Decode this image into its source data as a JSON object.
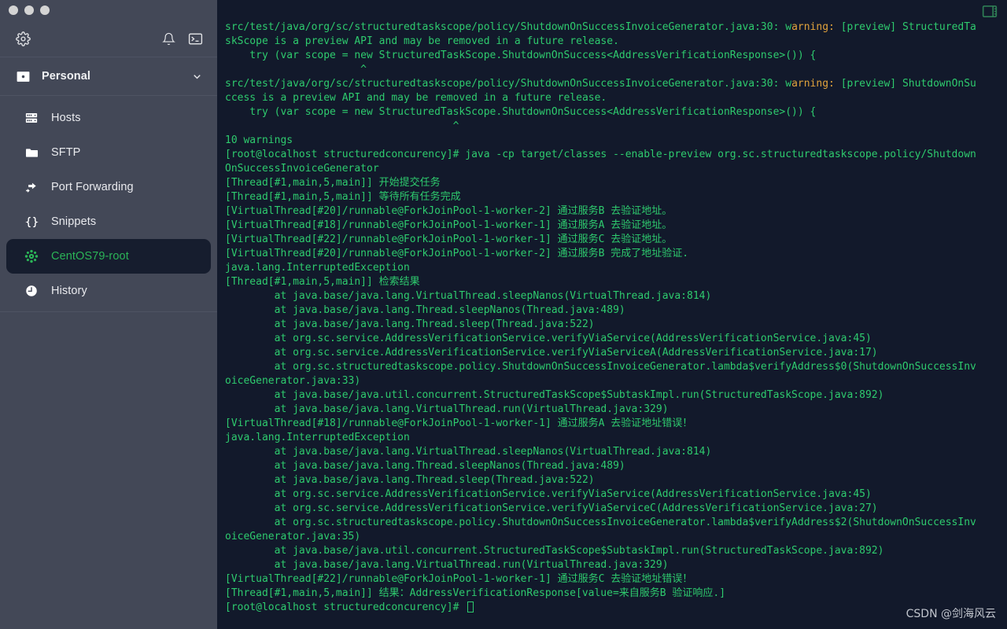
{
  "window": {
    "dots": [
      "close",
      "minimize",
      "maximize"
    ]
  },
  "sidebar": {
    "toolbar": {
      "settings_icon": "gear-icon",
      "notifications_icon": "bell-icon",
      "terminal_icon": "terminal-icon"
    },
    "vault": {
      "icon": "vault-icon",
      "label": "Personal",
      "chevron": "chevron-down-icon"
    },
    "items": [
      {
        "icon": "server-icon",
        "label": "Hosts",
        "selected": false
      },
      {
        "icon": "folder-icon",
        "label": "SFTP",
        "selected": false
      },
      {
        "icon": "port-forwarding-icon",
        "label": "Port Forwarding",
        "selected": false
      },
      {
        "icon": "braces-icon",
        "label": "Snippets",
        "selected": false
      },
      {
        "icon": "centos-icon",
        "label": "CentOS79-root",
        "selected": true
      },
      {
        "icon": "clock-icon",
        "label": "History",
        "selected": false
      }
    ]
  },
  "terminal": {
    "split_pane_icon": "split-pane-icon",
    "watermark": "CSDN @剑海风云",
    "prompt": "[root@localhost structuredconcurency]# ",
    "lines": [
      {
        "text": "src/test/java/org/sc/structuredtaskscope/policy/ShutdownOnSuccessInvoiceGenerator.java:30: warning: [preview] StructuredTa",
        "warn_from": 92,
        "warn_to": 100
      },
      {
        "text": "skScope is a preview API and may be removed in a future release."
      },
      {
        "text": "    try (var scope = new StructuredTaskScope.ShutdownOnSuccess<AddressVerificationResponse>()) {"
      },
      {
        "text": "                      ^"
      },
      {
        "text": "src/test/java/org/sc/structuredtaskscope/policy/ShutdownOnSuccessInvoiceGenerator.java:30: warning: [preview] ShutdownOnSu",
        "warn_from": 92,
        "warn_to": 100
      },
      {
        "text": "ccess is a preview API and may be removed in a future release."
      },
      {
        "text": "    try (var scope = new StructuredTaskScope.ShutdownOnSuccess<AddressVerificationResponse>()) {"
      },
      {
        "text": "                                     ^"
      },
      {
        "text": "10 warnings"
      },
      {
        "text": "[root@localhost structuredconcurency]# java -cp target/classes --enable-preview org.sc.structuredtaskscope.policy/Shutdown"
      },
      {
        "text": "OnSuccessInvoiceGenerator"
      },
      {
        "text": "[Thread[#1,main,5,main]] 开始提交任务"
      },
      {
        "text": "[Thread[#1,main,5,main]] 等待所有任务完成"
      },
      {
        "text": "[VirtualThread[#20]/runnable@ForkJoinPool-1-worker-2] 通过服务B 去验证地址。"
      },
      {
        "text": "[VirtualThread[#18]/runnable@ForkJoinPool-1-worker-1] 通过服务A 去验证地址。"
      },
      {
        "text": "[VirtualThread[#22]/runnable@ForkJoinPool-1-worker-1] 通过服务C 去验证地址。"
      },
      {
        "text": "[VirtualThread[#20]/runnable@ForkJoinPool-1-worker-2] 通过服务B 完成了地址验证."
      },
      {
        "text": "java.lang.InterruptedException"
      },
      {
        "text": "[Thread[#1,main,5,main]] 检索结果"
      },
      {
        "text": "        at java.base/java.lang.VirtualThread.sleepNanos(VirtualThread.java:814)"
      },
      {
        "text": "        at java.base/java.lang.Thread.sleepNanos(Thread.java:489)"
      },
      {
        "text": "        at java.base/java.lang.Thread.sleep(Thread.java:522)"
      },
      {
        "text": "        at org.sc.service.AddressVerificationService.verifyViaService(AddressVerificationService.java:45)"
      },
      {
        "text": "        at org.sc.service.AddressVerificationService.verifyViaServiceA(AddressVerificationService.java:17)"
      },
      {
        "text": "        at org.sc.structuredtaskscope.policy.ShutdownOnSuccessInvoiceGenerator.lambda$verifyAddress$0(ShutdownOnSuccessInv"
      },
      {
        "text": "oiceGenerator.java:33)"
      },
      {
        "text": "        at java.base/java.util.concurrent.StructuredTaskScope$SubtaskImpl.run(StructuredTaskScope.java:892)"
      },
      {
        "text": "        at java.base/java.lang.VirtualThread.run(VirtualThread.java:329)"
      },
      {
        "text": "[VirtualThread[#18]/runnable@ForkJoinPool-1-worker-1] 通过服务A 去验证地址错误！"
      },
      {
        "text": "java.lang.InterruptedException"
      },
      {
        "text": "        at java.base/java.lang.VirtualThread.sleepNanos(VirtualThread.java:814)"
      },
      {
        "text": "        at java.base/java.lang.Thread.sleepNanos(Thread.java:489)"
      },
      {
        "text": "        at java.base/java.lang.Thread.sleep(Thread.java:522)"
      },
      {
        "text": "        at org.sc.service.AddressVerificationService.verifyViaService(AddressVerificationService.java:45)"
      },
      {
        "text": "        at org.sc.service.AddressVerificationService.verifyViaServiceC(AddressVerificationService.java:27)"
      },
      {
        "text": "        at org.sc.structuredtaskscope.policy.ShutdownOnSuccessInvoiceGenerator.lambda$verifyAddress$2(ShutdownOnSuccessInv"
      },
      {
        "text": "oiceGenerator.java:35)"
      },
      {
        "text": "        at java.base/java.util.concurrent.StructuredTaskScope$SubtaskImpl.run(StructuredTaskScope.java:892)"
      },
      {
        "text": "        at java.base/java.lang.VirtualThread.run(VirtualThread.java:329)"
      },
      {
        "text": "[VirtualThread[#22]/runnable@ForkJoinPool-1-worker-1] 通过服务C 去验证地址错误！"
      },
      {
        "text": "[Thread[#1,main,5,main]] 结果：AddressVerificationResponse[value=来自服务B 验证响应.]"
      }
    ]
  },
  "colors": {
    "sidebar_bg": "#434857",
    "terminal_bg": "#12192b",
    "terminal_green": "#2ecb6e",
    "warning_orange": "#e0a23c",
    "selected_bg": "#161d2e",
    "selected_text": "#2bb457"
  }
}
